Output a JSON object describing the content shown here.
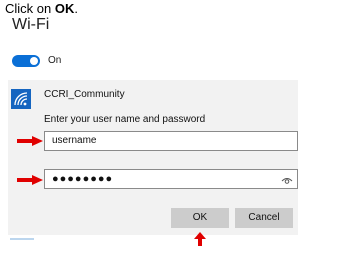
{
  "instruction": {
    "prefix": "Click on ",
    "target": "OK",
    "suffix": "."
  },
  "page": {
    "title": "Wi-Fi"
  },
  "wifi_toggle": {
    "state_label": "On",
    "state": true
  },
  "dialog": {
    "network_name": "CCRI_Community",
    "network_icon": "wifi-secured-icon",
    "prompt": "Enter your user name and password",
    "username_value": "username",
    "password_value": "●●●●●●●●",
    "password_reveal_icon": "eye-icon",
    "ok_label": "OK",
    "cancel_label": "Cancel"
  },
  "annotations": {
    "arrow_color": "#e00000",
    "arrows": [
      "arrow-right-icon",
      "arrow-right-icon",
      "arrow-up-icon"
    ]
  },
  "colors": {
    "accent": "#0a6fd6",
    "network_icon_bg": "#1565c0",
    "panel_bg": "#f2f2f2",
    "button_bg": "#cccccc"
  }
}
